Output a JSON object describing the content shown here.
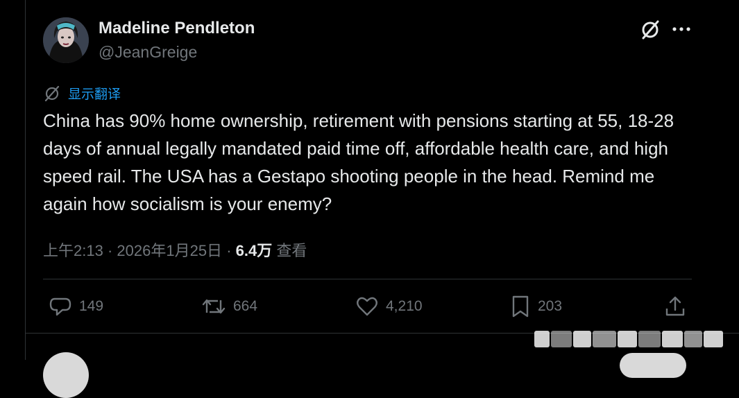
{
  "author": {
    "name": "Madeline Pendleton",
    "handle": "@JeanGreige"
  },
  "header_icons": {
    "grok": "grok-icon",
    "more": "more-icon"
  },
  "translate": {
    "label": "显示翻译",
    "icon": "translate-icon"
  },
  "tweet": {
    "text": "China has 90% home ownership, retirement with pensions starting at 55, 18-28 days of annual legally mandated paid time off, affordable health care, and high speed rail. The USA has a Gestapo shooting people in the head. Remind me again how socialism is your enemy?"
  },
  "meta": {
    "time": "上午2:13",
    "separator": "·",
    "date": "2026年1月25日",
    "views_count": "6.4万",
    "views_label": "查看"
  },
  "actions": {
    "replies": "149",
    "reposts": "664",
    "likes": "4,210",
    "bookmarks": "203"
  },
  "colors": {
    "background": "#000000",
    "text": "#e7e9ea",
    "muted": "#71767b",
    "accent": "#1d9bf0",
    "border": "#2f3336"
  }
}
